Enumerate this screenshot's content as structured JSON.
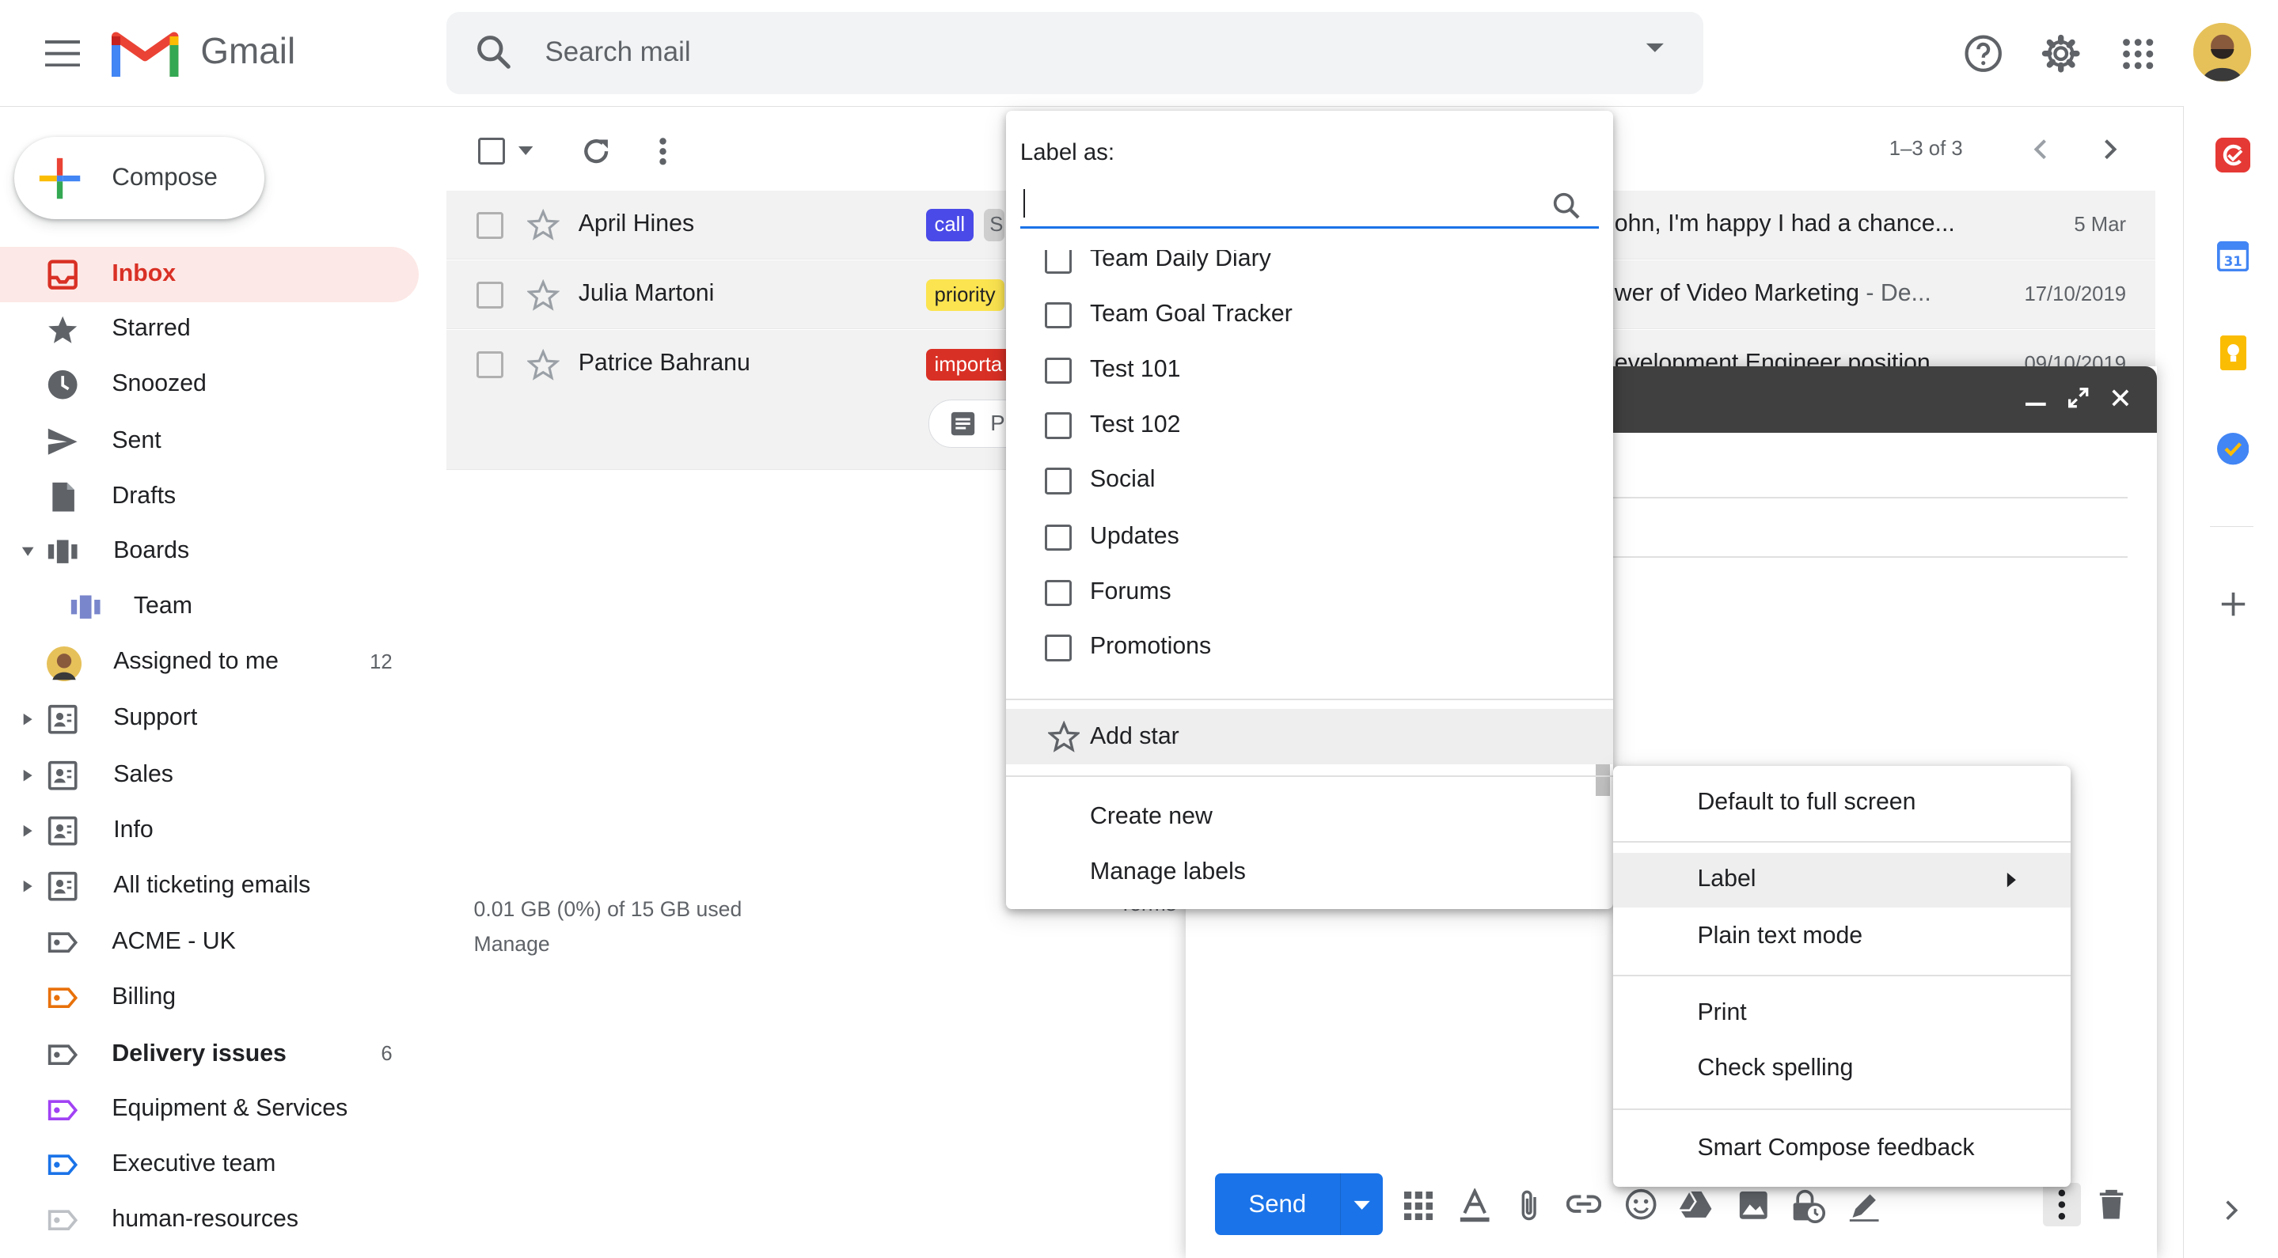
{
  "header": {
    "app_name": "Gmail",
    "search_placeholder": "Search mail"
  },
  "sidebar": {
    "compose_label": "Compose",
    "items": [
      {
        "label": "Inbox",
        "count": ""
      },
      {
        "label": "Starred",
        "count": ""
      },
      {
        "label": "Snoozed",
        "count": ""
      },
      {
        "label": "Sent",
        "count": ""
      },
      {
        "label": "Drafts",
        "count": ""
      },
      {
        "label": "Boards",
        "count": ""
      },
      {
        "label": "Team",
        "count": ""
      },
      {
        "label": "Assigned to me",
        "count": "12"
      },
      {
        "label": "Support",
        "count": ""
      },
      {
        "label": "Sales",
        "count": ""
      },
      {
        "label": "Info",
        "count": ""
      },
      {
        "label": "All ticketing emails",
        "count": ""
      },
      {
        "label": "ACME - UK",
        "count": ""
      },
      {
        "label": "Billing",
        "count": ""
      },
      {
        "label": "Delivery issues",
        "count": "6"
      },
      {
        "label": "Equipment & Services",
        "count": ""
      },
      {
        "label": "Executive team",
        "count": ""
      },
      {
        "label": "human-resources",
        "count": ""
      }
    ]
  },
  "toolbar": {
    "pagination": "1–3 of 3"
  },
  "emails": [
    {
      "sender": "April Hines",
      "tag": "call",
      "tag2": "S",
      "snippet": "ohn, I'm happy I had a chance...",
      "date": "5 Mar"
    },
    {
      "sender": "Julia Martoni",
      "tag": "priority",
      "snippet": "wer of Video Marketing",
      "snippet_tail": " - De...",
      "date": "17/10/2019"
    },
    {
      "sender": "Patrice Bahranu",
      "tag": "importa",
      "snippet": "evelopment Engineer position",
      "date": "09/10/2019",
      "chip": "P"
    }
  ],
  "storage": {
    "usage": "0.01 GB (0%) of 15 GB used",
    "manage": "Manage",
    "terms": "Terms"
  },
  "compose": {
    "send_label": "Send"
  },
  "label_menu": {
    "title": "Label as:",
    "labels": [
      "Team Daily Diary",
      "Team Goal Tracker",
      "Test 101",
      "Test 102",
      "Social",
      "Updates",
      "Forums",
      "Promotions"
    ],
    "add_star": "Add star",
    "create_new": "Create new",
    "manage_labels": "Manage labels"
  },
  "more_menu": {
    "items": [
      "Default to full screen",
      "Label",
      "Plain text mode",
      "Print",
      "Check spelling",
      "Smart Compose feedback"
    ]
  },
  "colors": {
    "accent_blue": "#1a73e8",
    "gmail_red": "#d93025"
  }
}
